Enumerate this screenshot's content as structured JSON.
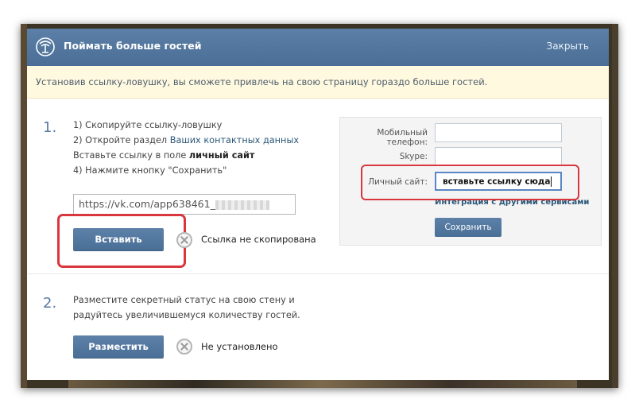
{
  "header": {
    "title": "Поймать больше гостей",
    "close_label": "Закрыть"
  },
  "notice": "Установив ссылку-ловушку, вы сможете привлечь на свою страницу гораздо больше гостей.",
  "step1": {
    "number": "1.",
    "line1": "1) Скопируйте ссылку-ловушку",
    "line2_prefix": "2) Откройте раздел ",
    "line2_link": "Ваших контактных данных",
    "line3_prefix": "Вставьте ссылку в поле ",
    "line3_bold": "личный сайт",
    "line4": "4) Нажмите кнопку \"Сохранить\"",
    "url_value": "https://vk.com/app638461_",
    "button_label": "Вставить",
    "status_text": "Ссылка не скопирована"
  },
  "panel": {
    "phone_label": "Мобильный телефон:",
    "skype_label": "Skype:",
    "site_label": "Личный сайт:",
    "site_value": "вставьте ссылку сюда",
    "integration_link": "Интеграция с другими сервисами",
    "save_label": "Сохранить"
  },
  "step2": {
    "number": "2.",
    "line1": "Разместите секретный статус на свою стену и",
    "line2": "радуйтесь увеличившемуся количеству гостей.",
    "button_label": "Разместить",
    "status_text": "Не установлено"
  },
  "colors": {
    "header": "#4a6e96",
    "highlight": "#d9363e",
    "notice_bg": "#fff9e0",
    "link": "#2b587a"
  }
}
